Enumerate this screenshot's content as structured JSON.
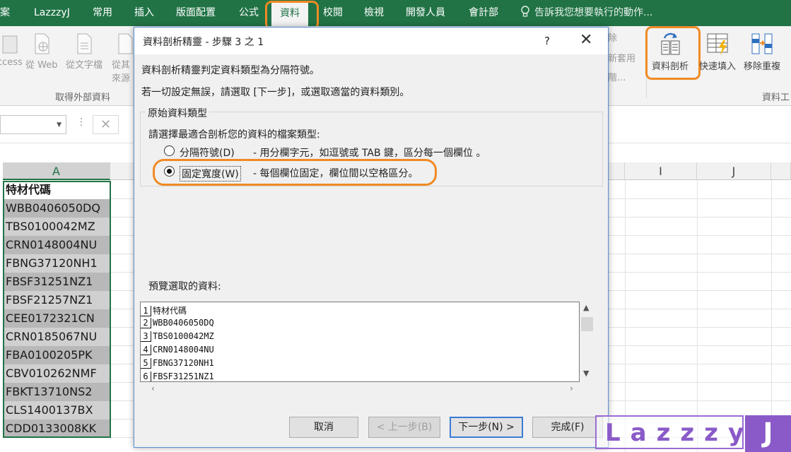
{
  "ribbon": {
    "tabs": [
      "案",
      "LazzzyJ",
      "常用",
      "插入",
      "版面配置",
      "公式",
      "資料",
      "校閱",
      "檢視",
      "開發人員",
      "會計部"
    ],
    "active_tab": "資料",
    "tell_me": "告訴我您想要執行的動作...",
    "buttons": {
      "access": "ccess",
      "from_web": "從 Web",
      "from_text": "從文字檔",
      "from_other_1": "從其",
      "from_other_2": "來源",
      "remove_partial": "除",
      "new_apply": "新套用",
      "advanced_partial": "階...",
      "text_to_columns": "資料剖析",
      "flash_fill": "快速填入",
      "remove_duplicates": "移除重複"
    },
    "groups": {
      "get_external": "取得外部資料",
      "data_tools": "資料工"
    }
  },
  "sheet": {
    "columns": [
      "A",
      "I",
      "J"
    ],
    "cells": [
      "特材代碼",
      "WBB0406050DQ",
      "TBS0100042MZ",
      "CRN0148004NU",
      "FBNG37120NH1",
      "FBSF31251NZ1",
      "FBSF21257NZ1",
      "CEE0172321CN",
      "CRN0185067NU",
      "FBA0100205PK",
      "CBV010262NMF",
      "FBKT13710NS2",
      "CLS1400137BX",
      "CDD0133008KK"
    ]
  },
  "dialog": {
    "title": "資料剖析精靈 - 步驟 3 之 1",
    "help": "?",
    "close": "✕",
    "line1": "資料剖析精靈判定資料類型為分隔符號。",
    "line2": "若一切設定無誤，請選取 [下一步]，或選取適當的資料類別。",
    "group_title": "原始資料類型",
    "prompt": "請選擇最適合剖析您的資料的檔案類型:",
    "option_delimited": "分隔符號(D)",
    "option_delimited_desc": "- 用分欄字元，如逗號或 TAB 鍵，區分每一個欄位 。",
    "option_fixed": "固定寬度(W)",
    "option_fixed_desc": "- 每個欄位固定，欄位間以空格區分。",
    "preview_label": "預覽選取的資料:",
    "preview_rows": [
      {
        "n": "1",
        "text": "特材代碼"
      },
      {
        "n": "2",
        "text": "WBB0406050DQ"
      },
      {
        "n": "3",
        "text": "TBS0100042MZ"
      },
      {
        "n": "4",
        "text": "CRN0148004NU"
      },
      {
        "n": "5",
        "text": "FBNG37120NH1"
      },
      {
        "n": "6",
        "text": "FBSF31251NZ1"
      }
    ],
    "buttons": {
      "cancel": "取消",
      "back": "< 上一步(B)",
      "next": "下一步(N) >",
      "finish": "完成(F)"
    }
  },
  "watermark": {
    "text": "Lazzzy",
    "j": "J"
  },
  "colors": {
    "excel_green": "#217346",
    "highlight": "#f08a24",
    "watermark": "#8a5ac8"
  }
}
